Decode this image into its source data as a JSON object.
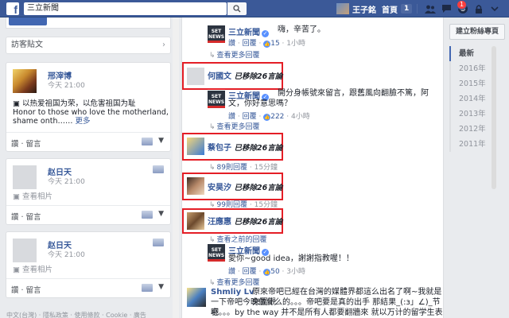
{
  "topbar": {
    "logo": "f",
    "search_value": "三立新聞",
    "profile_name": "王子銘",
    "home_label": "首頁",
    "home_count": "1",
    "notif_count": "1"
  },
  "left": {
    "visitor_header": "訪客貼文",
    "posts": [
      {
        "name": "邢滓博",
        "time": "今天 21:00",
        "body_line1": "以热爱祖国为荣，以危害祖国为耻",
        "body_line2": "Honor to those who love the motherland,",
        "body_line3": "shame onth……",
        "more": "更多",
        "actions": "讚 · 留言"
      },
      {
        "name": "赵日天",
        "time": "今天 21:00",
        "body_line1": "查看相片",
        "actions": "讚 · 留言"
      },
      {
        "name": "赵日天",
        "time": "今天 21:00",
        "body_line1": "查看相片",
        "actions": "讚 · 留言"
      }
    ],
    "footer": "中文(台灣) · 隱私政策 · 使用條款 · Cookie · 廣告"
  },
  "center": {
    "items": [
      {
        "name": "三立新聞",
        "text": "嗨，辛苦了。",
        "meta_like": "讚",
        "meta_reply": "回覆",
        "likes": "15",
        "time": "1小時"
      },
      {
        "more": "查看更多回覆"
      },
      {
        "name": "何國文",
        "deleted": "已移除26言論"
      },
      {
        "name": "三立新聞",
        "text": "開分身帳號來留言，跟舊風向翻臉不篤，阿文，你好意思嗎？",
        "meta_like": "讚",
        "meta_reply": "回覆",
        "likes": "222",
        "time": "4小時"
      },
      {
        "more": "查看更多回覆"
      },
      {
        "name": "蔡包子",
        "deleted": "已移除26言論"
      },
      {
        "more": "89則回覆",
        "time": "15分鐘"
      },
      {
        "name": "安昊汐",
        "deleted": "已移除26言論"
      },
      {
        "more": "99則回覆",
        "time": "15分鐘"
      },
      {
        "name": "汪應惠",
        "deleted": "已移除26言論"
      },
      {
        "more": "查看之前的回覆"
      },
      {
        "name": "三立新聞",
        "text": "愛你~good idea，謝謝指教喔！！",
        "meta_like": "讚",
        "meta_reply": "回覆",
        "likes": "50",
        "time": "3小時"
      },
      {
        "more": "查看更多回覆"
      },
      {
        "name": "Shmliy Lv",
        "text_line1": "原來帝吧已經在台灣的媒體界都這么出名了啊~我就是來圍觀",
        "text_line2": "一下帝吧今晚做什么的。。。帝吧要是真的出手 那結果_(:з」∠)_节哀",
        "text_line3": "吧。。。by the way 并不是所有人都要翻牆來 就以万计的留学生表示不"
      }
    ]
  },
  "right": {
    "follow_button": "建立粉絲專頁",
    "timeline": [
      "最新",
      "2016年",
      "2015年",
      "2014年",
      "2013年",
      "2012年",
      "2011年"
    ]
  }
}
